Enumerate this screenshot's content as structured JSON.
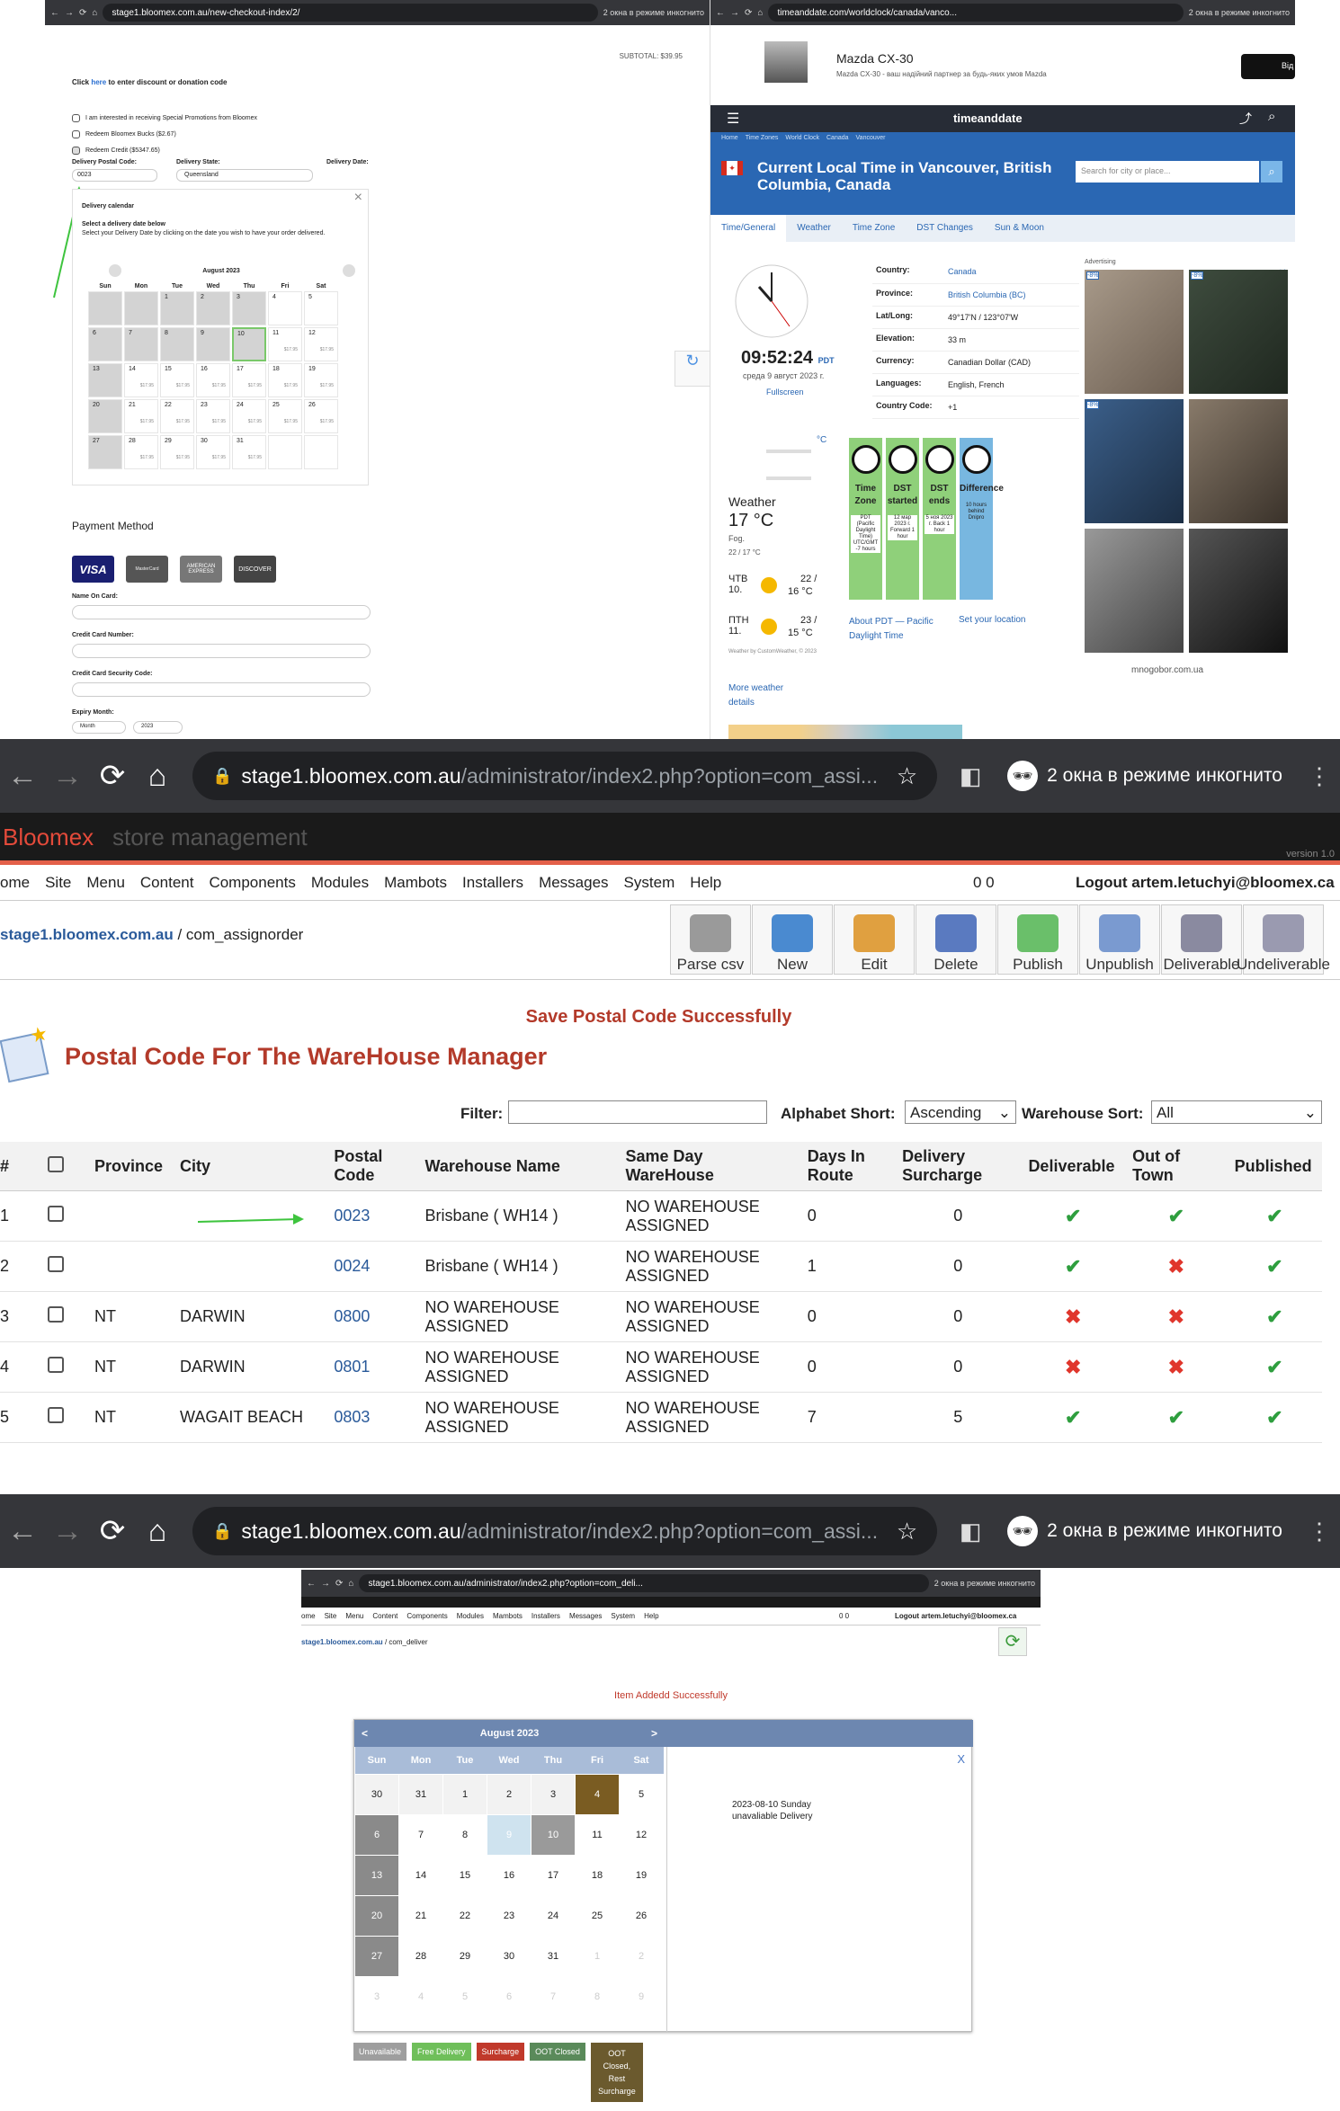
{
  "panel_a": {
    "tab_url": "stage1.bloomex.com.au/new-checkout-index/2/",
    "incognito": "2 окна в режиме инкогнито",
    "subtotal": "SUBTOTAL: $39.95",
    "discount_prefix": "Click ",
    "discount_link": "here",
    "discount_suffix": " to enter discount or donation code",
    "checks": [
      "I am interested in receiving Special Promotions from Bloomex",
      "Redeem Bloomex Bucks ($2.67)",
      "Redeem Credit ($5347.65)"
    ],
    "postal_label": "Delivery Postal Code:",
    "postal_value": "0023",
    "state_label": "Delivery State:",
    "state_value": "Queensland",
    "date_label": "Delivery Date:",
    "cal_title": "Delivery calendar",
    "cal_hint": "Select a delivery date below",
    "cal_desc": "Select your Delivery Date by clicking on the date you wish to have your order delivered.",
    "cal_month": "August 2023",
    "days": [
      "Sun",
      "Mon",
      "Tue",
      "Wed",
      "Thu",
      "Fri",
      "Sat"
    ],
    "weeks": [
      [
        [
          "",
          ""
        ],
        [
          "",
          ""
        ],
        [
          "1",
          ""
        ],
        [
          "2",
          ""
        ],
        [
          "3",
          ""
        ],
        [
          "4",
          ""
        ],
        [
          "5",
          ""
        ]
      ],
      [
        [
          "6",
          ""
        ],
        [
          "7",
          ""
        ],
        [
          "8",
          ""
        ],
        [
          "9",
          ""
        ],
        [
          "10",
          ""
        ],
        [
          "11",
          "$17.95"
        ],
        [
          "12",
          "$17.95"
        ]
      ],
      [
        [
          "13",
          ""
        ],
        [
          "14",
          "$17.95"
        ],
        [
          "15",
          "$17.95"
        ],
        [
          "16",
          "$17.95"
        ],
        [
          "17",
          "$17.95"
        ],
        [
          "18",
          "$17.95"
        ],
        [
          "19",
          "$17.95"
        ]
      ],
      [
        [
          "20",
          ""
        ],
        [
          "21",
          "$17.95"
        ],
        [
          "22",
          "$17.95"
        ],
        [
          "23",
          "$17.95"
        ],
        [
          "24",
          "$17.95"
        ],
        [
          "25",
          "$17.95"
        ],
        [
          "26",
          "$17.95"
        ]
      ],
      [
        [
          "27",
          ""
        ],
        [
          "28",
          "$17.95"
        ],
        [
          "29",
          "$17.95"
        ],
        [
          "30",
          "$17.95"
        ],
        [
          "31",
          "$17.95"
        ],
        [
          "",
          ""
        ],
        [
          "",
          ""
        ]
      ]
    ],
    "payment_title": "Payment Method",
    "cards": [
      "VISA",
      "MasterCard",
      "AMERICAN EXPRESS",
      "DISCOVER"
    ],
    "fields": [
      "Name On Card:",
      "Credit Card Number:",
      "Credit Card Security Code:",
      "Expiry Month:"
    ],
    "expiry_month": "Month",
    "expiry_year": "2023"
  },
  "panel_b": {
    "tab_url": "timeanddate.com/worldclock/canada/vanco...",
    "incognito": "2 окна в режиме инкогнито",
    "ad_title": "Mazda CX-30",
    "ad_text": "Mazda CX-30 - ваш надійний партнер за будь-яких умов Mazda",
    "ad_btn": "Від",
    "logo": "timeanddate",
    "crumbs": [
      "Home",
      "Time Zones",
      "World Clock",
      "Canada",
      "Vancouver"
    ],
    "heading": "Current Local Time in Vancouver, British Columbia, Canada",
    "search_placeholder": "Search for city or place...",
    "tabs": [
      "Time/General",
      "Weather",
      "Time Zone",
      "DST Changes",
      "Sun & Moon"
    ],
    "time": "09:52:24",
    "tz": "PDT",
    "date": "среда 9 август 2023 г.",
    "fullscreen": "Fullscreen",
    "info": [
      [
        "Country:",
        "Canada"
      ],
      [
        "Province:",
        "British Columbia (BC)"
      ],
      [
        "Lat/Long:",
        "49°17'N / 123°07'W"
      ],
      [
        "Elevation:",
        "33 m"
      ],
      [
        "Currency:",
        "Canadian Dollar (CAD)"
      ],
      [
        "Languages:",
        "English, French"
      ],
      [
        "Country Code:",
        "+1"
      ]
    ],
    "unit": "°C",
    "weather_label": "Weather",
    "temp": "17 °C",
    "cond": "Fog.",
    "range": "22 / 17 °C",
    "fc": [
      [
        "ЧТВ",
        "10.",
        "22 /",
        "16 °C"
      ],
      [
        "ПТН",
        "11.",
        "23 /",
        "15 °C"
      ]
    ],
    "weather_by": "Weather by CustomWeather, © 2023",
    "more_weather": "More weather details",
    "cards": [
      [
        "Time Zone",
        "PDT (Pacific Daylight Time) UTC/GMT -7 hours"
      ],
      [
        "DST started",
        "12 мар 2023 г. Forward 1 hour"
      ],
      [
        "DST ends",
        "5 ноя 2023 г. Back 1 hour"
      ],
      [
        "Difference",
        "10 hours behind Dnipro"
      ]
    ],
    "about": "About PDT — Pacific Daylight Time",
    "set_loc": "Set your location",
    "advertising": "Advertising",
    "discounts": [
      "-8%",
      "-8%",
      "-8%"
    ],
    "ad_domain": "mnogobor.com.ua"
  },
  "panel_c": {
    "url_host": "stage1.bloomex.com.au",
    "url_path": "/administrator/index2.php?option=com_assi...",
    "incognito": "2 окна в режиме инкогнито",
    "brand": "Bloomex",
    "brand_sub": "store management",
    "version": "version 1.0",
    "menu": [
      "ome",
      "Site",
      "Menu",
      "Content",
      "Components",
      "Modules",
      "Mambots",
      "Installers",
      "Messages",
      "System",
      "Help"
    ],
    "counts": "0  0",
    "logout": "Logout artem.letuchyi@bloomex.ca",
    "crumb_link": "stage1.bloomex.com.au",
    "crumb_rest": "/ com_assignorder",
    "tools": [
      "Parse csv",
      "New",
      "Edit",
      "Delete",
      "Publish",
      "Unpublish",
      "Deliverable",
      "Undeliverable"
    ],
    "message": "Save Postal Code Successfully",
    "title": "Postal Code For The WareHouse Manager",
    "filter_label": "Filter:",
    "sort_label": "Alphabet Short:",
    "sort_value": "Ascending",
    "wh_label": "Warehouse Sort:",
    "wh_value": "All",
    "cols": [
      "#",
      "",
      "Province",
      "City",
      "Postal Code",
      "Warehouse Name",
      "Same Day WareHouse",
      "Days In Route",
      "Delivery Surcharge",
      "Deliverable",
      "Out of Town",
      "Published"
    ],
    "rows": [
      {
        "n": "1",
        "prov": "",
        "city": "",
        "code": "0023",
        "wh": "Brisbane ( WH14 )",
        "same": "NO WAREHOUSE ASSIGNED",
        "days": "0",
        "sur": "0",
        "del": "yes",
        "oot": "yes",
        "pub": "yes"
      },
      {
        "n": "2",
        "prov": "",
        "city": "",
        "code": "0024",
        "wh": "Brisbane ( WH14 )",
        "same": "NO WAREHOUSE ASSIGNED",
        "days": "1",
        "sur": "0",
        "del": "yes",
        "oot": "no",
        "pub": "yes"
      },
      {
        "n": "3",
        "prov": "NT",
        "city": "DARWIN",
        "code": "0800",
        "wh": "NO WAREHOUSE ASSIGNED",
        "same": "NO WAREHOUSE ASSIGNED",
        "days": "0",
        "sur": "0",
        "del": "no",
        "oot": "no",
        "pub": "yes"
      },
      {
        "n": "4",
        "prov": "NT",
        "city": "DARWIN",
        "code": "0801",
        "wh": "NO WAREHOUSE ASSIGNED",
        "same": "NO WAREHOUSE ASSIGNED",
        "days": "0",
        "sur": "0",
        "del": "no",
        "oot": "no",
        "pub": "yes"
      },
      {
        "n": "5",
        "prov": "NT",
        "city": "WAGAIT BEACH",
        "code": "0803",
        "wh": "NO WAREHOUSE ASSIGNED",
        "same": "NO WAREHOUSE ASSIGNED",
        "days": "7",
        "sur": "5",
        "del": "yes",
        "oot": "yes",
        "pub": "yes"
      }
    ],
    "partial": "NO WAREHOUSE"
  },
  "panel_d": {
    "url_host": "stage1.bloomex.com.au",
    "url_path": "/administrator/index2.php?option=com_assi...",
    "incognito": "2 окна в режиме инкогнито",
    "inner_url": "stage1.bloomex.com.au/administrator/index2.php?option=com_deli...",
    "inner_incognito": "2 окна в режиме инкогнито",
    "menu": [
      "ome",
      "Site",
      "Menu",
      "Content",
      "Components",
      "Modules",
      "Mambots",
      "Installers",
      "Messages",
      "System",
      "Help"
    ],
    "counts": "0  0",
    "logout": "Logout artem.letuchyi@bloomex.ca",
    "crumb_link": "stage1.bloomex.com.au",
    "crumb_rest": "/ com_deliver",
    "message": "Item Addedd Successfully",
    "month": "August 2023",
    "prev": "<",
    "next": ">",
    "days": [
      "Sun",
      "Mon",
      "Tue",
      "Wed",
      "Thu",
      "Fri",
      "Sat"
    ],
    "weeks": [
      [
        "30",
        "31",
        "1",
        "2",
        "3",
        "4",
        "5"
      ],
      [
        "6",
        "7",
        "8",
        "9",
        "10",
        "11",
        "12"
      ],
      [
        "13",
        "14",
        "15",
        "16",
        "17",
        "18",
        "19"
      ],
      [
        "20",
        "21",
        "22",
        "23",
        "24",
        "25",
        "26"
      ],
      [
        "27",
        "28",
        "29",
        "30",
        "31",
        "1",
        "2"
      ],
      [
        "3",
        "4",
        "5",
        "6",
        "7",
        "8",
        "9"
      ]
    ],
    "note": "2023-08-10 Sunday unavaliable Delivery",
    "close": "X",
    "legend": [
      "Unavailable",
      "Free Delivery",
      "Surcharge",
      "OOT Closed",
      "OOT Closed, Rest Surcharge"
    ],
    "legend_colors": [
      "#9e9e9e",
      "#6fbf5a",
      "#c0392b",
      "#5a8a5a",
      "#6b5a2e"
    ]
  }
}
